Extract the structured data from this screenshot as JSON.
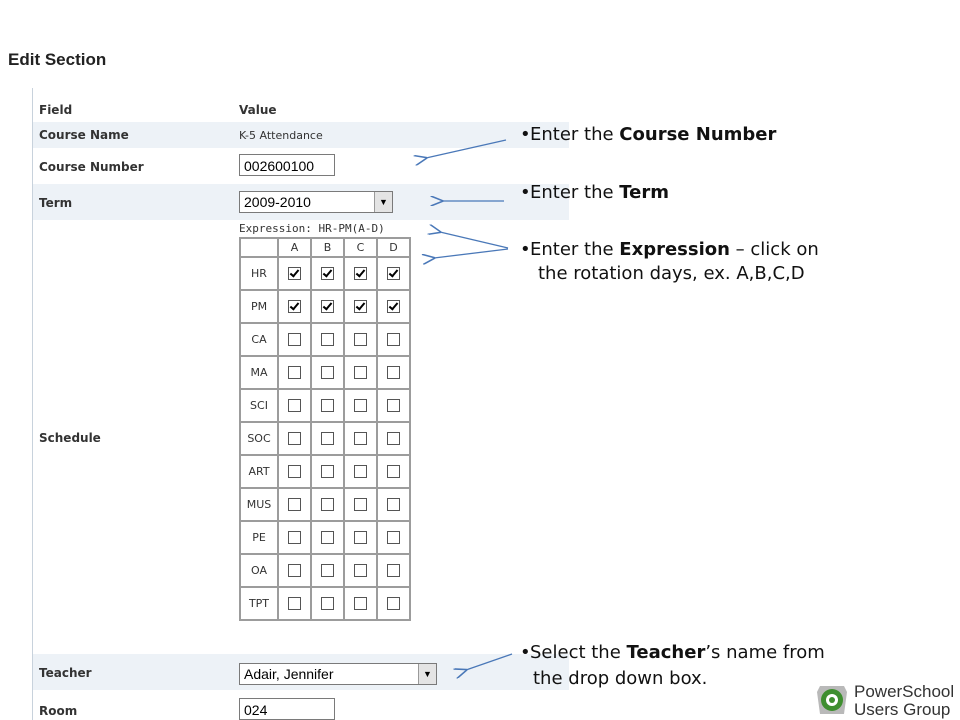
{
  "page": {
    "title": "Edit Section"
  },
  "form": {
    "header": {
      "field": "Field",
      "value": "Value"
    },
    "course_name": {
      "label": "Course Name",
      "value": "K-5 Attendance"
    },
    "course_number": {
      "label": "Course Number",
      "value": "002600100"
    },
    "term": {
      "label": "Term",
      "value": "2009-2010"
    },
    "schedule": {
      "label": "Schedule",
      "expression": "Expression: HR-PM(A-D)",
      "days": [
        "A",
        "B",
        "C",
        "D"
      ],
      "periods": [
        {
          "name": "HR",
          "checked": [
            true,
            true,
            true,
            true
          ]
        },
        {
          "name": "PM",
          "checked": [
            true,
            true,
            true,
            true
          ]
        },
        {
          "name": "CA",
          "checked": [
            false,
            false,
            false,
            false
          ]
        },
        {
          "name": "MA",
          "checked": [
            false,
            false,
            false,
            false
          ]
        },
        {
          "name": "SCI",
          "checked": [
            false,
            false,
            false,
            false
          ]
        },
        {
          "name": "SOC",
          "checked": [
            false,
            false,
            false,
            false
          ]
        },
        {
          "name": "ART",
          "checked": [
            false,
            false,
            false,
            false
          ]
        },
        {
          "name": "MUS",
          "checked": [
            false,
            false,
            false,
            false
          ]
        },
        {
          "name": "PE",
          "checked": [
            false,
            false,
            false,
            false
          ]
        },
        {
          "name": "OA",
          "checked": [
            false,
            false,
            false,
            false
          ]
        },
        {
          "name": "TPT",
          "checked": [
            false,
            false,
            false,
            false
          ]
        }
      ]
    },
    "teacher": {
      "label": "Teacher",
      "value": "Adair, Jennifer"
    },
    "room": {
      "label": "Room",
      "value": "024"
    }
  },
  "notes": {
    "course_number": {
      "pre": "Enter the ",
      "bold": "Course Number"
    },
    "term": {
      "pre": "Enter the ",
      "bold": "Term"
    },
    "expression": {
      "pre": "Enter the ",
      "bold": "Expression",
      "post": " – click on",
      "cont": "the rotation days, ex. A,B,C,D"
    },
    "teacher": {
      "pre": "Select the ",
      "bold": "Teacher",
      "post": "’s name from",
      "cont": "the drop down box."
    }
  },
  "logo": {
    "line1": "PowerSchool",
    "line2": "Users Group"
  },
  "colors": {
    "row_shade": "#edf2f7",
    "arrow": "#4a78b8",
    "logo_green": "#3e8e2f"
  },
  "icons": {
    "checkbox": "checkbox-icon",
    "dropdown": "dropdown-arrow-icon",
    "logo": "powerschool-logo-icon"
  }
}
